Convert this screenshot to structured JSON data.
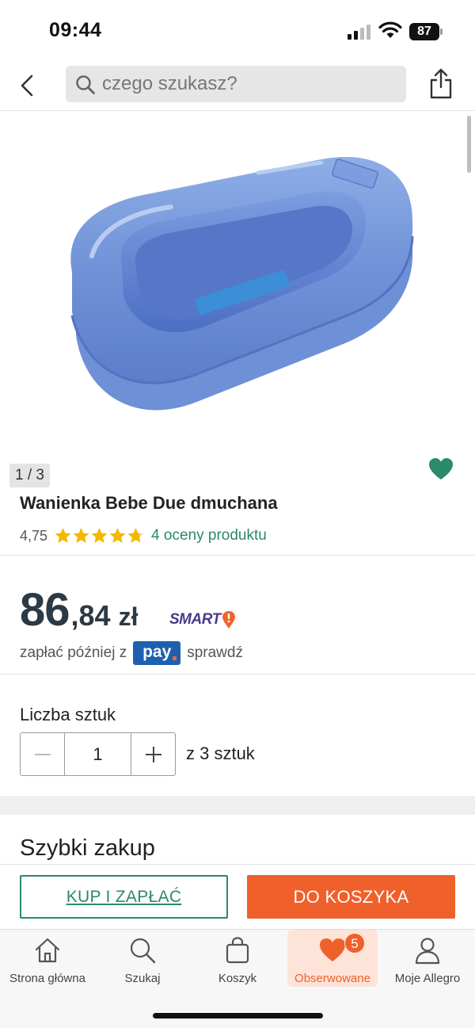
{
  "status_bar": {
    "time": "09:44",
    "battery": "87"
  },
  "search": {
    "placeholder": "czego szukasz?"
  },
  "gallery": {
    "counter": "1 / 3"
  },
  "product": {
    "title": "Wanienka Bebe Due dmuchana",
    "rating_value": "4,75",
    "rating_stars": 4.75,
    "rating_link": "4 oceny produktu"
  },
  "price": {
    "integer": "86",
    "decimal": ",84",
    "currency": "zł",
    "smart_label": "SMART"
  },
  "pay_later": {
    "prefix": "zapłać później z",
    "logo_text": "pay",
    "link": "sprawdź"
  },
  "quantity": {
    "label": "Liczba sztuk",
    "value": "1",
    "of_text": "z 3 sztuk"
  },
  "quick_buy": {
    "title": "Szybki zakup"
  },
  "actions": {
    "buy_label": "KUP I ZAPŁAĆ",
    "cart_label": "DO KOSZYKA"
  },
  "tabs": [
    {
      "label": "Strona główna",
      "icon": "home-icon"
    },
    {
      "label": "Szukaj",
      "icon": "search-icon"
    },
    {
      "label": "Koszyk",
      "icon": "bag-icon"
    },
    {
      "label": "Obserwowane",
      "icon": "heart-icon",
      "badge": "5",
      "active": true
    },
    {
      "label": "Moje Allegro",
      "icon": "user-icon"
    }
  ],
  "colors": {
    "accent": "#f0602a",
    "green": "#2b8a68",
    "price": "#2b3a45",
    "smart": "#4b3a8c",
    "pay": "#1f5fb0"
  }
}
